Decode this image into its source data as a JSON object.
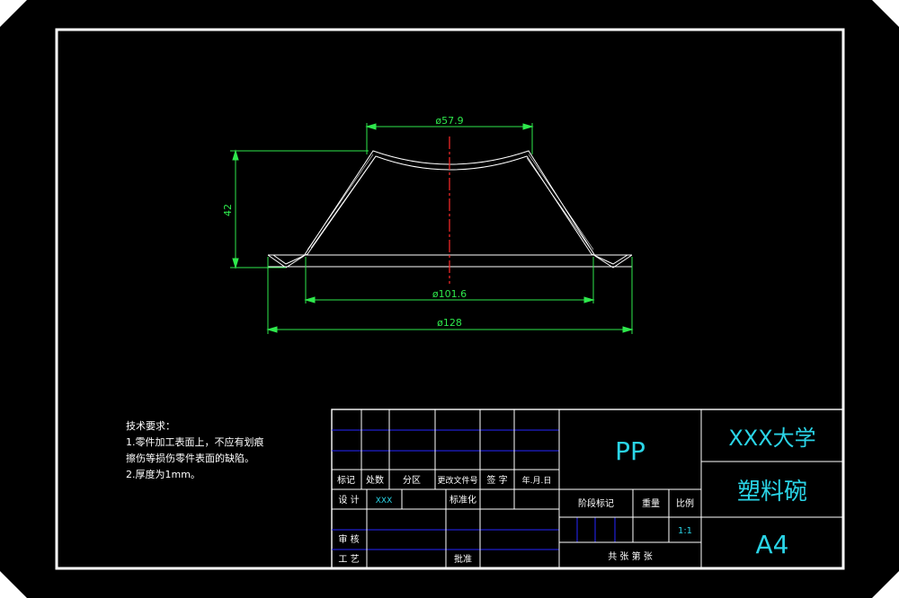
{
  "dimensions": {
    "top_diameter": "ø57.9",
    "height": "42",
    "mid_diameter": "ø101.6",
    "flange_diameter": "ø128"
  },
  "technical_requirements": {
    "heading": "技术要求：",
    "lines": [
      "1.零件加工表面上，不应有划痕",
      "擦伤等损伤零件表面的缺陷。",
      "2.厚度为1mm。"
    ]
  },
  "title_block": {
    "material": "PP",
    "institution": "XXX大学",
    "part_name": "塑料碗",
    "sheet_size": "A4",
    "row_labels": [
      "标记",
      "处数",
      "分区",
      "更改文件号",
      "签 字",
      "年.月.日"
    ],
    "design_label": "设 计",
    "designer": "XXX",
    "standardization_label": "标准化",
    "review_label": "审 核",
    "process_label": "工 艺",
    "approval_label": "批准",
    "stage_mark_label": "阶段标记",
    "weight_label": "重量",
    "scale_label": "比例",
    "scale_value": "1:1",
    "sheets_text": "共    张    第    张"
  },
  "colors": {
    "background": "#000000",
    "lines": "#ffffff",
    "dimension": "#2ee84c",
    "centerline": "#ff2a2a",
    "text_cyan": "#2ad4e6",
    "grid_blue": "#2626ff"
  }
}
